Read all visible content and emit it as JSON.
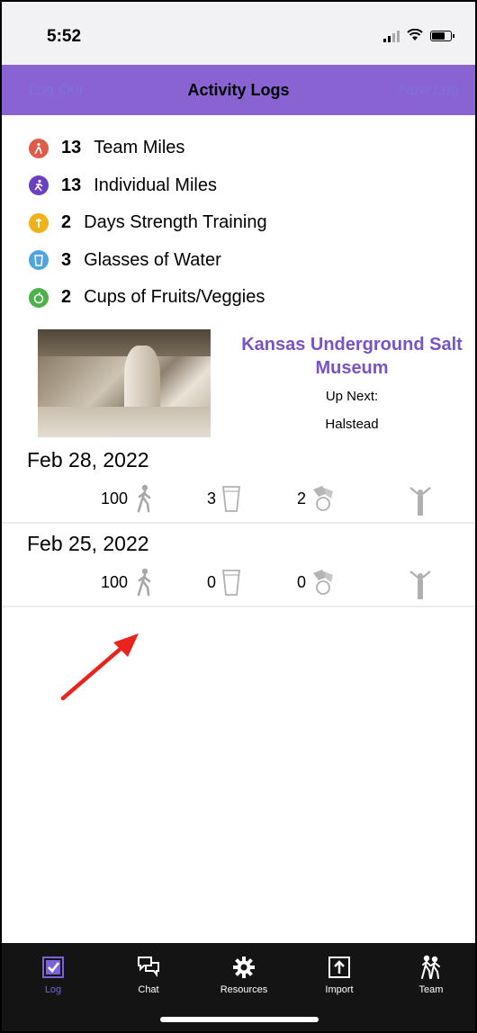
{
  "status_bar": {
    "time": "5:52"
  },
  "nav": {
    "left_label": "Log Out",
    "title": "Activity Logs",
    "right_label": "New Log"
  },
  "colors": {
    "accent": "#8a63d2",
    "purple_text": "#7a52c7",
    "tab_bar": "#141414"
  },
  "summary": [
    {
      "icon": "walker-icon",
      "color": "#e05b4a",
      "value": "13",
      "label": "Team Miles"
    },
    {
      "icon": "runner-icon",
      "color": "#6a3fc2",
      "value": "13",
      "label": "Individual Miles"
    },
    {
      "icon": "strength-icon",
      "color": "#f0b21a",
      "value": "2",
      "label": "Days Strength Training"
    },
    {
      "icon": "water-glass-icon",
      "color": "#4fa3e0",
      "value": "3",
      "label": "Glasses of Water"
    },
    {
      "icon": "fruit-icon",
      "color": "#4db04a",
      "value": "2",
      "label": "Cups of Fruits/Veggies"
    }
  ],
  "destination": {
    "name": "Kansas Underground Salt Museum",
    "up_next_label": "Up Next:",
    "up_next_value": "Halstead"
  },
  "entries": [
    {
      "date": "Feb 28, 2022",
      "miles": "100",
      "water": "3",
      "fruits": "2"
    },
    {
      "date": "Feb 25, 2022",
      "miles": "100",
      "water": "0",
      "fruits": "0"
    }
  ],
  "tabs": [
    {
      "label": "Log",
      "icon": "checkbox-icon",
      "active": true
    },
    {
      "label": "Chat",
      "icon": "chat-bubbles-icon"
    },
    {
      "label": "Resources",
      "icon": "gear-icon"
    },
    {
      "label": "Import",
      "icon": "upload-icon"
    },
    {
      "label": "Team",
      "icon": "team-walkers-icon"
    }
  ]
}
